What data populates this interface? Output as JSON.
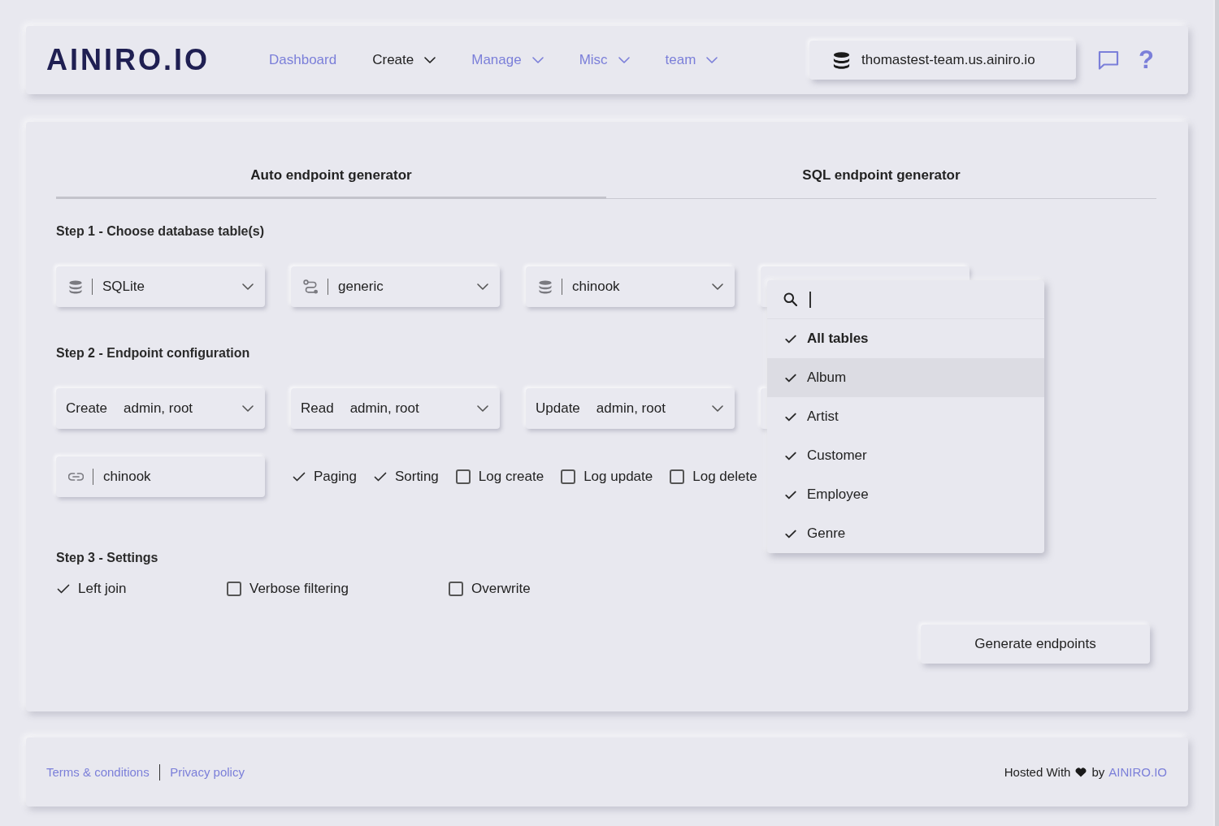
{
  "header": {
    "logo": "AINIRO.IO",
    "nav": [
      {
        "label": "Dashboard",
        "selected": false,
        "dropdown": false
      },
      {
        "label": "Create",
        "selected": true,
        "dropdown": true
      },
      {
        "label": "Manage",
        "selected": false,
        "dropdown": true
      },
      {
        "label": "Misc",
        "selected": false,
        "dropdown": true
      },
      {
        "label": "team",
        "selected": false,
        "dropdown": true
      }
    ],
    "host_button": "thomastest-team.us.ainiro.io",
    "help": "?"
  },
  "tabs": [
    {
      "label": "Auto endpoint generator",
      "selected": true
    },
    {
      "label": "SQL endpoint generator",
      "selected": false
    }
  ],
  "step1": {
    "title": "Step 1 - Choose database table(s)",
    "selects": [
      {
        "kind": "database_type",
        "value": "SQLite"
      },
      {
        "kind": "connection",
        "value": "generic"
      },
      {
        "kind": "database",
        "value": "chinook"
      },
      {
        "kind": "tables",
        "expanded": true,
        "menu": {
          "search_focused": true,
          "items": [
            {
              "kind": "all",
              "label": "All tables",
              "checked": true,
              "highlighted": false
            },
            {
              "kind": "table",
              "label": "Album",
              "checked": true,
              "highlighted": true
            },
            {
              "kind": "table",
              "label": "Artist",
              "checked": true,
              "highlighted": false
            },
            {
              "kind": "table",
              "label": "Customer",
              "checked": true,
              "highlighted": false
            },
            {
              "kind": "table",
              "label": "Employee",
              "checked": true,
              "highlighted": false
            },
            {
              "kind": "table",
              "label": "Genre",
              "checked": true,
              "highlighted": false
            }
          ]
        }
      }
    ]
  },
  "step2": {
    "title": "Step 2 - Endpoint configuration",
    "permissions": [
      {
        "kind": "verb",
        "verb": "Create",
        "roles": "admin, root"
      },
      {
        "kind": "verb",
        "verb": "Read",
        "roles": "admin, root"
      },
      {
        "kind": "verb",
        "verb": "Update",
        "roles": "admin, root"
      },
      {
        "kind": "empty"
      }
    ],
    "url_field": {
      "value": "chinook"
    },
    "options": [
      {
        "label": "Paging",
        "checked": true
      },
      {
        "label": "Sorting",
        "checked": true
      },
      {
        "label": "Log create",
        "checked": false
      },
      {
        "label": "Log update",
        "checked": false
      },
      {
        "label": "Log delete",
        "checked": false
      }
    ]
  },
  "step3": {
    "title": "Step 3 - Settings",
    "options": [
      {
        "label": "Left join",
        "checked": true
      },
      {
        "label": "Verbose filtering",
        "checked": false
      },
      {
        "label": "Overwrite",
        "checked": false
      }
    ]
  },
  "generate_button": "Generate endpoints",
  "footer": {
    "links": [
      "Terms & conditions",
      "Privacy policy"
    ],
    "hosted_prefix": "Hosted With",
    "hosted_by": "by",
    "brand_link": "AINIRO.IO"
  }
}
